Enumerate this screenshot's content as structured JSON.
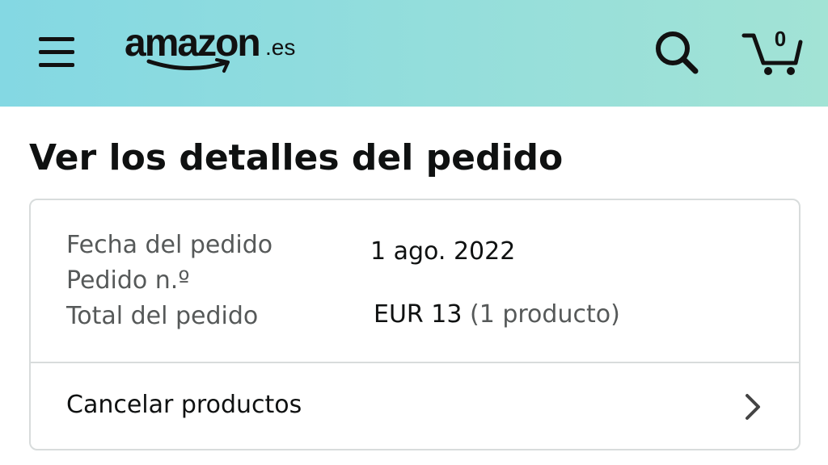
{
  "header": {
    "logo_word": "amazon",
    "logo_tld": ".es",
    "cart_count": "0",
    "background_colors": [
      "#84d8e3",
      "#a2e3d5"
    ],
    "icons": [
      "menu-icon",
      "search-icon",
      "cart-icon"
    ]
  },
  "page": {
    "title": "Ver los detalles del pedido"
  },
  "order": {
    "date_label": "Fecha del pedido",
    "date_value": "1 ago. 2022",
    "number_label": "Pedido n.º",
    "number_value": "",
    "total_label": "Total del pedido",
    "total_value": "EUR 13",
    "total_items": "(1 producto)"
  },
  "actions": {
    "cancel_label": "Cancelar productos",
    "cancel_icon": "chevron-right-icon"
  }
}
